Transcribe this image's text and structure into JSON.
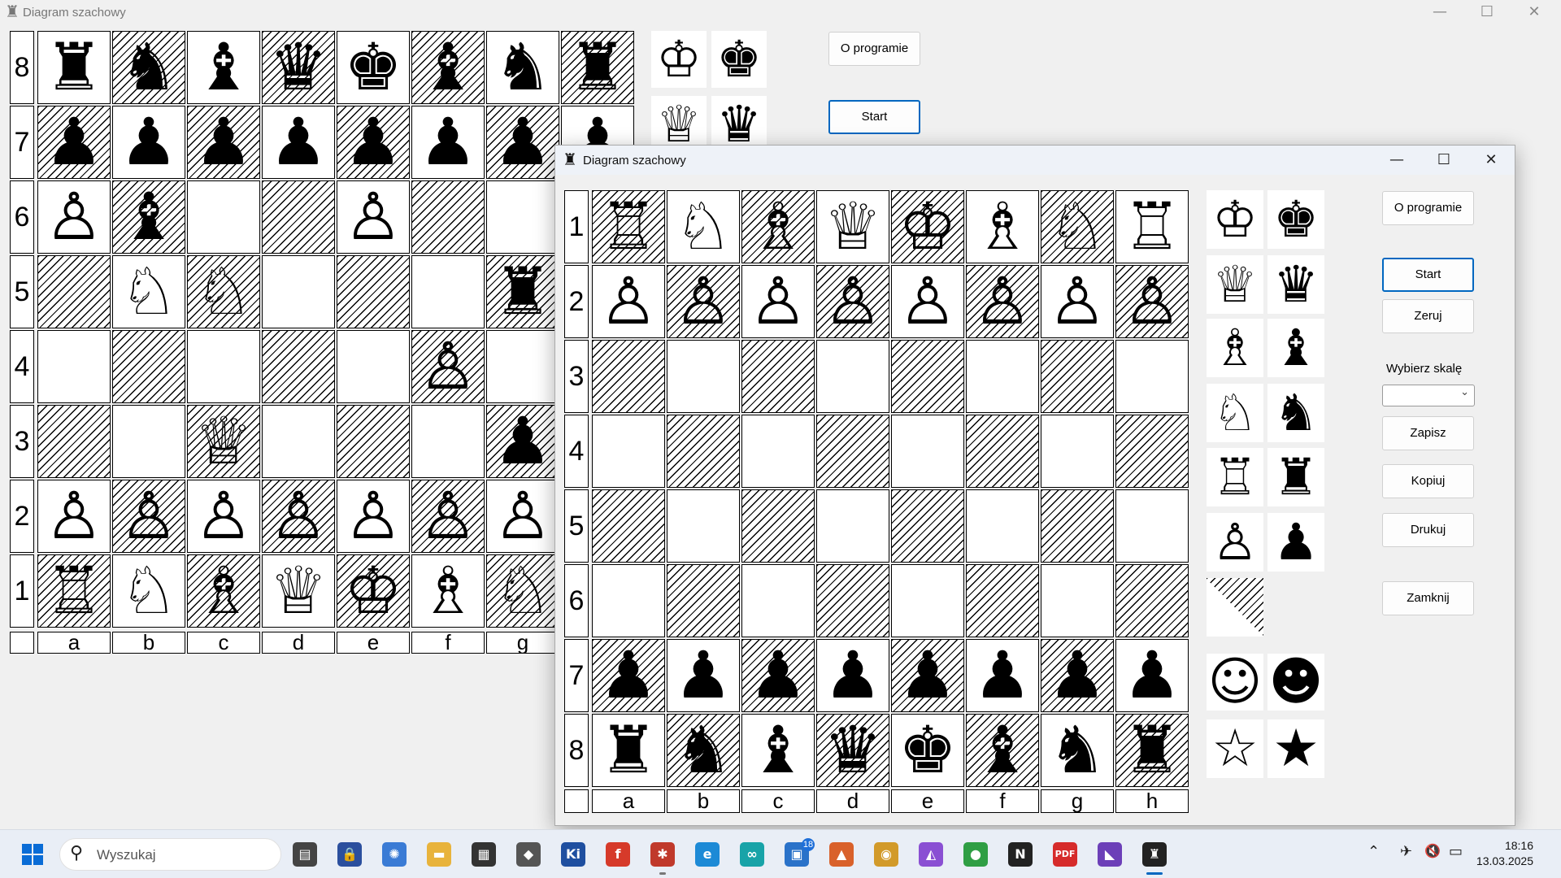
{
  "back_window": {
    "title": "Diagram szachowy",
    "icon": "♜",
    "orientation": "black-bottom",
    "ranks_top_to_bottom": [
      "8",
      "7",
      "6",
      "5",
      "4",
      "3",
      "2",
      "1"
    ],
    "files": [
      "a",
      "b",
      "c",
      "d",
      "e",
      "f",
      "g"
    ],
    "board": [
      [
        "♜",
        "♞",
        "♝",
        "♛",
        "♚",
        "♝",
        "♞",
        "♜"
      ],
      [
        "♟",
        "♟",
        "♟",
        "♟",
        "♟",
        "♟",
        "♟",
        "♟"
      ],
      [
        "♙",
        "♝",
        "",
        "",
        "♙",
        "",
        "",
        ""
      ],
      [
        "",
        "♘",
        "♘",
        "",
        "",
        "",
        "♜",
        ""
      ],
      [
        "",
        "",
        "",
        "",
        "",
        "♙",
        "",
        ""
      ],
      [
        "",
        "",
        "♕",
        "",
        "",
        "",
        "♟",
        ""
      ],
      [
        "♙",
        "♙",
        "♙",
        "♙",
        "♙",
        "♙",
        "♙",
        ""
      ],
      [
        "♖",
        "♘",
        "♗",
        "♕",
        "♔",
        "♗",
        "♘",
        ""
      ]
    ],
    "palette_pieces": [
      "♔",
      "♚",
      "♕",
      "♛"
    ],
    "buttons": {
      "about": "O programie",
      "start": "Start"
    }
  },
  "front_window": {
    "title": "Diagram szachowy",
    "icon": "♜",
    "orientation": "white-bottom",
    "ranks_top_to_bottom": [
      "1",
      "2",
      "3",
      "4",
      "5",
      "6",
      "7",
      "8"
    ],
    "files": [
      "a",
      "b",
      "c",
      "d",
      "e",
      "f",
      "g",
      "h"
    ],
    "board": [
      [
        "♖",
        "♘",
        "♗",
        "♕",
        "♔",
        "♗",
        "♘",
        "♖"
      ],
      [
        "♙",
        "♙",
        "♙",
        "♙",
        "♙",
        "♙",
        "♙",
        "♙"
      ],
      [
        "",
        "",
        "",
        "",
        "",
        "",
        "",
        ""
      ],
      [
        "",
        "",
        "",
        "",
        "",
        "",
        "",
        ""
      ],
      [
        "",
        "",
        "",
        "",
        "",
        "",
        "",
        ""
      ],
      [
        "",
        "",
        "",
        "",
        "",
        "",
        "",
        ""
      ],
      [
        "♟",
        "♟",
        "♟",
        "♟",
        "♟",
        "♟",
        "♟",
        "♟"
      ],
      [
        "♜",
        "♞",
        "♝",
        "♛",
        "♚",
        "♝",
        "♞",
        "♜"
      ]
    ],
    "palette_pieces": [
      [
        "♔",
        "♚"
      ],
      [
        "♕",
        "♛"
      ],
      [
        "♗",
        "♝"
      ],
      [
        "♘",
        "♞"
      ],
      [
        "♖",
        "♜"
      ],
      [
        "♙",
        "♟"
      ]
    ],
    "palette_symbols": {
      "smile_outline": "☺",
      "smile_filled": "☻",
      "star_outline": "☆",
      "star_filled": "★"
    },
    "buttons": {
      "about": "O programie",
      "start": "Start",
      "reset": "Zeruj",
      "save": "Zapisz",
      "copy": "Kopiuj",
      "print": "Drukuj",
      "close": "Zamknij"
    },
    "scale_label": "Wybierz skalę",
    "scale_value": ""
  },
  "window_controls": {
    "minimize": "—",
    "maximize": "☐",
    "close": "✕"
  },
  "taskbar": {
    "search_placeholder": "Wyszukaj",
    "apps": [
      {
        "name": "task-view",
        "label": "▤",
        "color": "#444444"
      },
      {
        "name": "keepass",
        "label": "🔒",
        "color": "#2b4f9e"
      },
      {
        "name": "globe",
        "label": "✺",
        "color": "#3a7bd5"
      },
      {
        "name": "file-explorer",
        "label": "▬",
        "color": "#e8b33c"
      },
      {
        "name": "apps-grid",
        "label": "▦",
        "color": "#333333"
      },
      {
        "name": "chessboard",
        "label": "◆",
        "color": "#555555"
      },
      {
        "name": "kicad",
        "label": "Ki",
        "color": "#1f4fa0"
      },
      {
        "name": "freemind",
        "label": "f",
        "color": "#d63a2a"
      },
      {
        "name": "ant",
        "label": "✱",
        "color": "#c0392b"
      },
      {
        "name": "edge",
        "label": "e",
        "color": "#1d8ad6"
      },
      {
        "name": "arduino",
        "label": "∞",
        "color": "#18a3a8"
      },
      {
        "name": "store",
        "label": "▣",
        "color": "#2a72c9",
        "badge": "18"
      },
      {
        "name": "matlab",
        "label": "▲",
        "color": "#d9612b"
      },
      {
        "name": "eye",
        "label": "◉",
        "color": "#d29a2a"
      },
      {
        "name": "affinity",
        "label": "◭",
        "color": "#8a4fd3"
      },
      {
        "name": "chrome",
        "label": "●",
        "color": "#2f9e44"
      },
      {
        "name": "notion",
        "label": "N",
        "color": "#222222"
      },
      {
        "name": "pdf",
        "label": "PDF",
        "color": "#d62b2b"
      },
      {
        "name": "visual-studio",
        "label": "◣",
        "color": "#6c3fb8"
      },
      {
        "name": "chess-app",
        "label": "♜",
        "color": "#222222"
      }
    ],
    "tray": {
      "chevron": "⌃",
      "network": "✈",
      "volume": "🔇",
      "battery": "▭"
    },
    "time": "18:16",
    "date": "13.03.2025"
  }
}
